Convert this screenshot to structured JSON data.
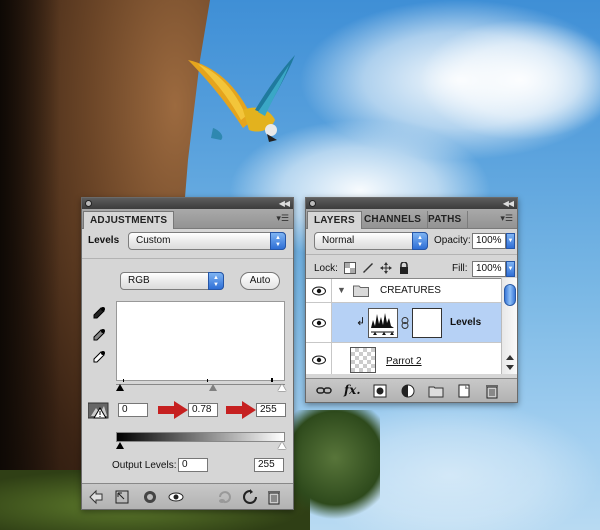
{
  "adjustments_panel": {
    "tab_label": "ADJUSTMENTS",
    "preset_label": "Levels",
    "preset_value": "Custom",
    "channel_value": "RGB",
    "auto_label": "Auto",
    "input_black": "0",
    "input_midtone": "0.78",
    "input_white": "255",
    "output_label": "Output Levels:",
    "output_black": "0",
    "output_white": "255"
  },
  "layers_panel": {
    "tabs": [
      "LAYERS",
      "CHANNELS",
      "PATHS"
    ],
    "blend_mode": "Normal",
    "opacity_label": "Opacity:",
    "opacity_value": "100%",
    "lock_label": "Lock:",
    "fill_label": "Fill:",
    "fill_value": "100%",
    "layers": [
      {
        "name": "CREATURES",
        "kind": "group"
      },
      {
        "name": "Levels",
        "kind": "adjustment",
        "selected": true
      },
      {
        "name": "Parrot 2",
        "kind": "pixel"
      }
    ]
  },
  "colors": {
    "panel_bg": "#d6d6d6",
    "selection": "#b6d1f5",
    "accent_blue": "#2f6fd6",
    "arrow_red": "#c62020"
  }
}
